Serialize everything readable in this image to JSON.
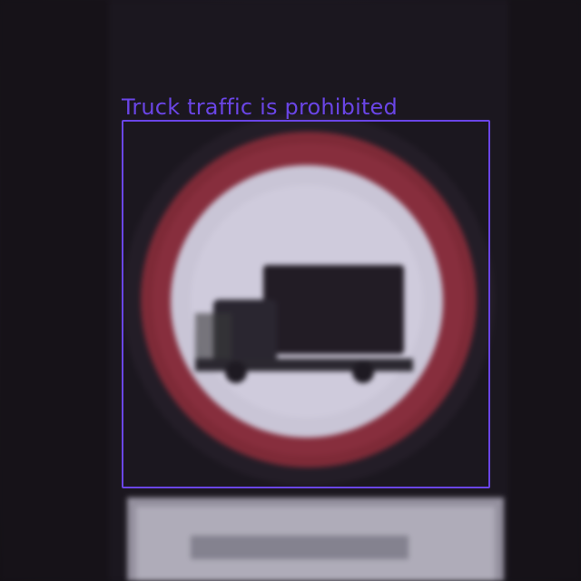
{
  "detection": {
    "label": "Truck traffic is prohibited",
    "color": "#6a45e6"
  },
  "scene": {
    "sign_ring_color": "#8a2a36",
    "sign_face_color": "#cfcbd9",
    "background_color": "#1c1820"
  }
}
